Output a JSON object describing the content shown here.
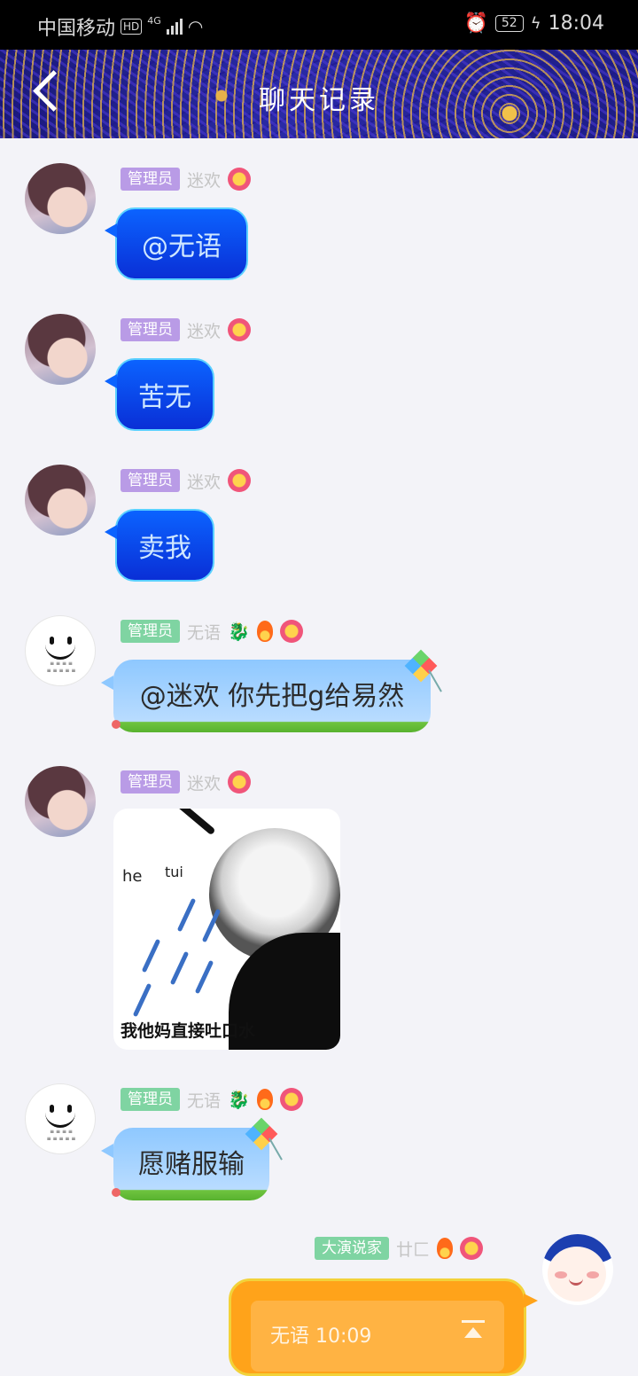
{
  "status": {
    "carrier": "中国移动",
    "hd": "HD",
    "network": "4G",
    "battery": "52",
    "time": "18:04"
  },
  "header": {
    "title": "聊天记录"
  },
  "messages": [
    {
      "badge": "管理员",
      "nick": "迷欢",
      "text": "@无语"
    },
    {
      "badge": "管理员",
      "nick": "迷欢",
      "text": "苦无"
    },
    {
      "badge": "管理员",
      "nick": "迷欢",
      "text": "卖我"
    },
    {
      "badge": "管理员",
      "nick": "无语",
      "text": "@迷欢 你先把g给易然"
    },
    {
      "badge": "管理员",
      "nick": "迷欢",
      "meme_he": "he",
      "meme_tui": "tui",
      "meme_caption": "我他妈直接吐口水"
    },
    {
      "badge": "管理员",
      "nick": "无语",
      "text": "愿赌服输"
    },
    {
      "badge": "大演说家",
      "nick": "廿匚",
      "quote": "无语 10:09"
    }
  ],
  "colors": {
    "blue_bubble": "#0b63ff",
    "admin_badge": "#b99be6",
    "green_badge": "#7fd4a2",
    "orange_bubble": "#ffa31a"
  }
}
